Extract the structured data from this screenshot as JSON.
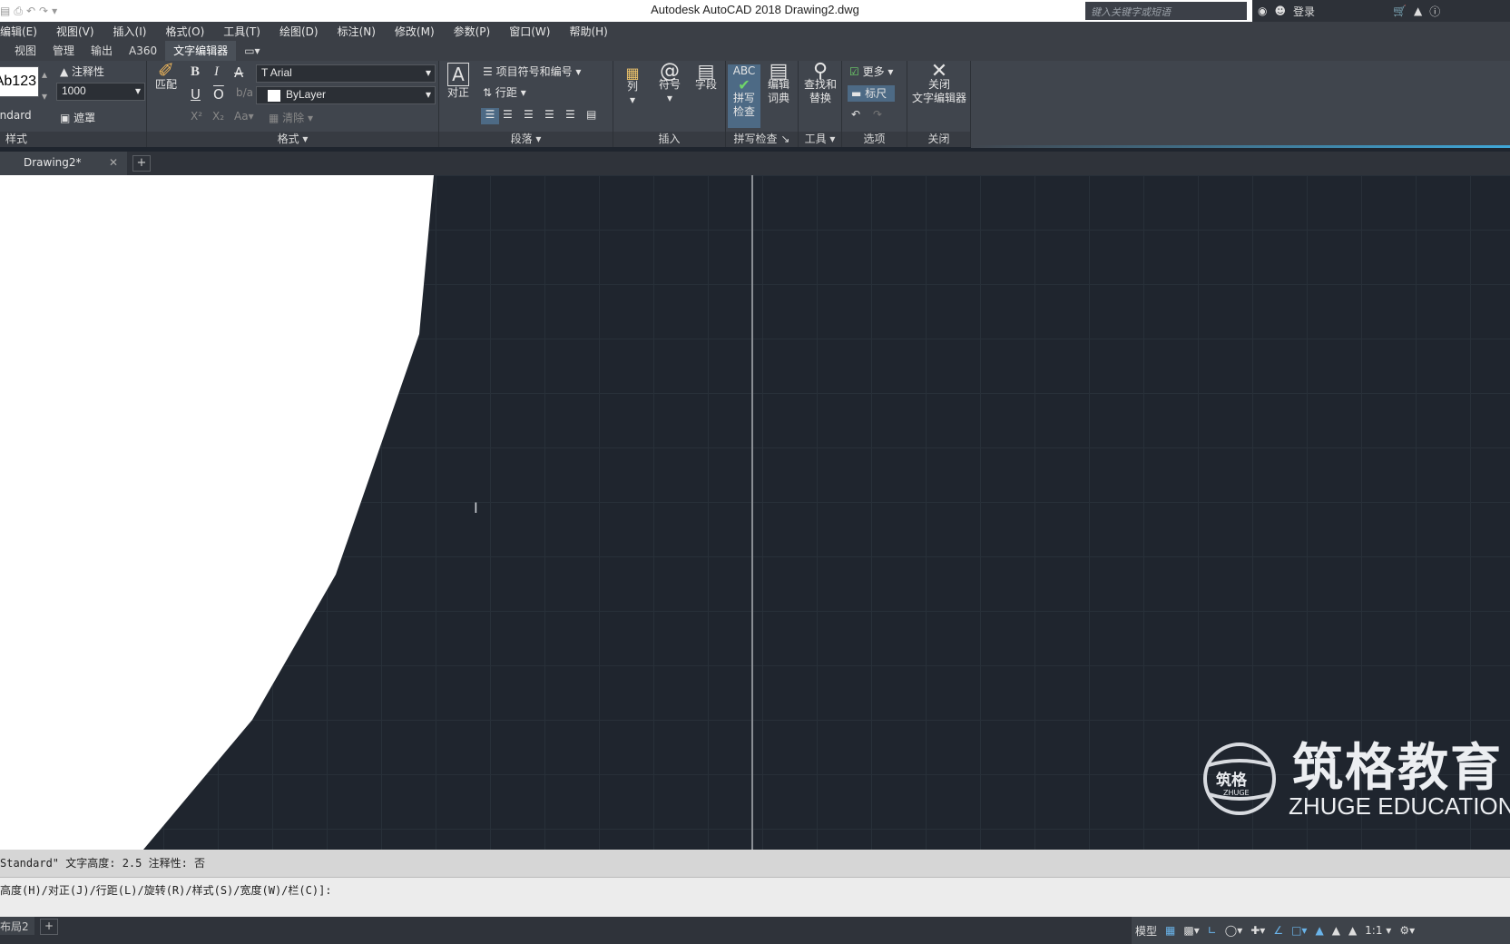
{
  "window": {
    "title": "Autodesk AutoCAD 2018    Drawing2.dwg",
    "search_placeholder": "键入关键字或短语",
    "login": "登录"
  },
  "menu": [
    "编辑(E)",
    "视图(V)",
    "插入(I)",
    "格式(O)",
    "工具(T)",
    "绘图(D)",
    "标注(N)",
    "修改(M)",
    "参数(P)",
    "窗口(W)",
    "帮助(H)"
  ],
  "ribbon_tabs": [
    "视图",
    "管理",
    "输出",
    "A360",
    "文字编辑器"
  ],
  "ribbon": {
    "style": {
      "preview": "Ab123",
      "style_name": "Standard",
      "annotative": "注释性",
      "height": "1000",
      "mask": "遮罩",
      "title": "样式"
    },
    "format": {
      "match": "匹配",
      "font": "Arial",
      "color": "ByLayer",
      "clear": "清除",
      "title": "格式"
    },
    "paragraph": {
      "justify": "对正",
      "bullets": "项目符号和编号",
      "line_spacing": "行距",
      "title": "段落"
    },
    "insert": {
      "columns": "列",
      "symbol": "符号",
      "field": "字段",
      "title": "插入"
    },
    "spell": {
      "check_line1": "拼写",
      "check_line2": "检查",
      "edit_dict_line1": "编辑",
      "edit_dict_line2": "词典",
      "abc": "ABC",
      "title": "拼写检查"
    },
    "tools": {
      "find_line1": "查找和",
      "find_line2": "替换",
      "title": "工具"
    },
    "options": {
      "more": "更多",
      "ruler": "标尺",
      "title": "选项"
    },
    "close": {
      "label_line1": "关闭",
      "label_line2": "文字编辑器",
      "title": "关闭"
    }
  },
  "doc_tab": "Drawing2*",
  "watermark": {
    "cn": "筑格教育",
    "en": "ZHUGE EDUCATION",
    "logo_cn": "筑格",
    "logo_en": "ZHUGE"
  },
  "command": {
    "history": "Standard\"  文字高度:  2.5  注释性:  否",
    "prompt": "高度(H)/对正(J)/行距(L)/旋转(R)/样式(S)/宽度(W)/栏(C)]:"
  },
  "layout_tab": "布局2",
  "status": {
    "model": "模型",
    "scale": "1:1"
  },
  "colors": {
    "canvas": "#1f252e",
    "ribbon": "#40454d",
    "accent": "#3fa7d8"
  }
}
